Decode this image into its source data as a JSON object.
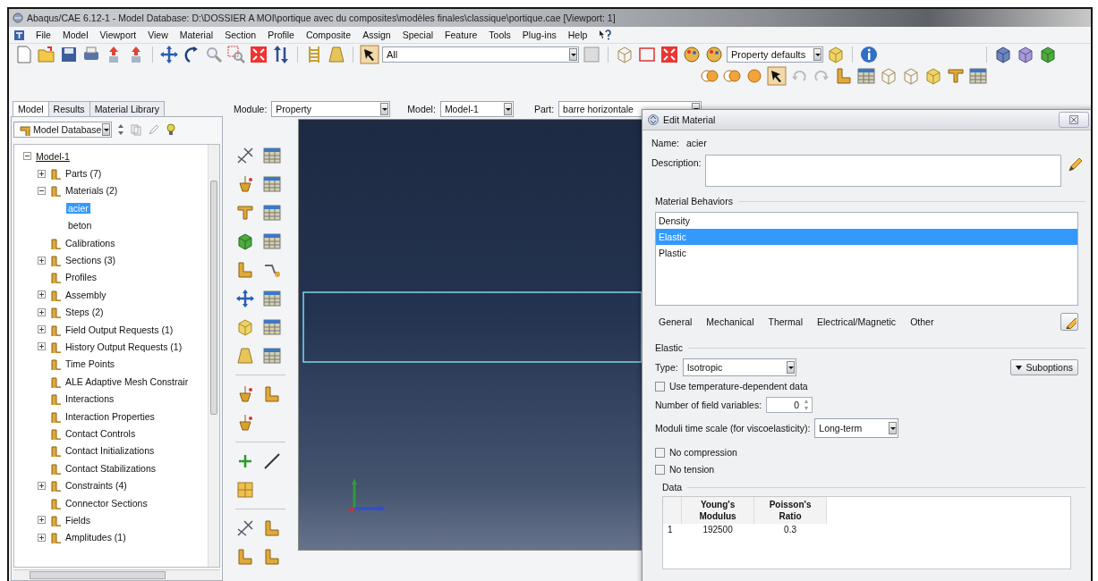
{
  "window": {
    "title": "Abaqus/CAE 6.12-1 - Model Database: D:\\DOSSIER A MOI\\portique avec du composites\\modèles finales\\classique\\portique.cae [Viewport: 1]"
  },
  "menu": [
    "File",
    "Model",
    "Viewport",
    "View",
    "Material",
    "Section",
    "Profile",
    "Composite",
    "Assign",
    "Special",
    "Feature",
    "Tools",
    "Plug-ins",
    "Help"
  ],
  "toolbar": {
    "selection_filter": "All",
    "render_defaults": "Property defaults"
  },
  "model_tree": {
    "tabs": [
      {
        "label": "Model",
        "selected": true
      },
      {
        "label": "Results",
        "selected": false
      },
      {
        "label": "Material Library",
        "selected": false
      }
    ],
    "source": "Model Database",
    "items": [
      {
        "label": "Model-1",
        "expanded": true,
        "selected": false,
        "children": [
          {
            "label": "Parts (7)",
            "expanded": false,
            "selected": false
          },
          {
            "label": "Materials (2)",
            "expanded": true,
            "selected": false,
            "children": [
              {
                "label": "acier",
                "selected": true
              },
              {
                "label": "beton",
                "selected": false
              }
            ]
          },
          {
            "label": "Calibrations",
            "selected": false
          },
          {
            "label": "Sections (3)",
            "expanded": false,
            "selected": false
          },
          {
            "label": "Profiles",
            "selected": false
          },
          {
            "label": "Assembly",
            "expanded": false,
            "selected": false
          },
          {
            "label": "Steps (2)",
            "expanded": false,
            "selected": false
          },
          {
            "label": "Field Output Requests (1)",
            "expanded": false,
            "selected": false
          },
          {
            "label": "History Output Requests (1)",
            "expanded": false,
            "selected": false
          },
          {
            "label": "Time Points",
            "selected": false
          },
          {
            "label": "ALE Adaptive Mesh Constrair",
            "selected": false
          },
          {
            "label": "Interactions",
            "selected": false
          },
          {
            "label": "Interaction Properties",
            "selected": false
          },
          {
            "label": "Contact Controls",
            "selected": false
          },
          {
            "label": "Contact Initializations",
            "selected": false
          },
          {
            "label": "Contact Stabilizations",
            "selected": false
          },
          {
            "label": "Constraints (4)",
            "expanded": false,
            "selected": false
          },
          {
            "label": "Connector Sections",
            "selected": false
          },
          {
            "label": "Fields",
            "expanded": false,
            "selected": false
          },
          {
            "label": "Amplitudes (1)",
            "expanded": false,
            "selected": false
          }
        ]
      }
    ]
  },
  "context_bar": {
    "module_label": "Module:",
    "module": "Property",
    "model_label": "Model:",
    "model": "Model-1",
    "part_label": "Part:",
    "part": "barre horizontale"
  },
  "dialog": {
    "title": "Edit Material",
    "name_label": "Name:",
    "name": "acier",
    "description_label": "Description:",
    "behaviors_label": "Material Behaviors",
    "behaviors": [
      {
        "label": "Density",
        "selected": false
      },
      {
        "label": "Elastic",
        "selected": true
      },
      {
        "label": "Plastic",
        "selected": false
      }
    ],
    "menus": [
      "General",
      "Mechanical",
      "Thermal",
      "Electrical/Magnetic",
      "Other"
    ],
    "section": "Elastic",
    "type_label": "Type:",
    "type": "Isotropic",
    "suboptions": "Suboptions",
    "temperature_dependent": {
      "label": "Use temperature-dependent data",
      "checked": false
    },
    "field_variables_label": "Number of field variables:",
    "field_variables": "0",
    "moduli_label": "Moduli time scale (for viscoelasticity):",
    "moduli": "Long-term",
    "options": [
      {
        "label": "No compression",
        "checked": false
      },
      {
        "label": "No tension",
        "checked": false
      }
    ],
    "data_label": "Data",
    "table": {
      "columns": [
        "",
        "Young's Modulus",
        "Poisson's Ratio"
      ],
      "rows": [
        [
          "1",
          "192500",
          "0.3"
        ]
      ]
    }
  }
}
